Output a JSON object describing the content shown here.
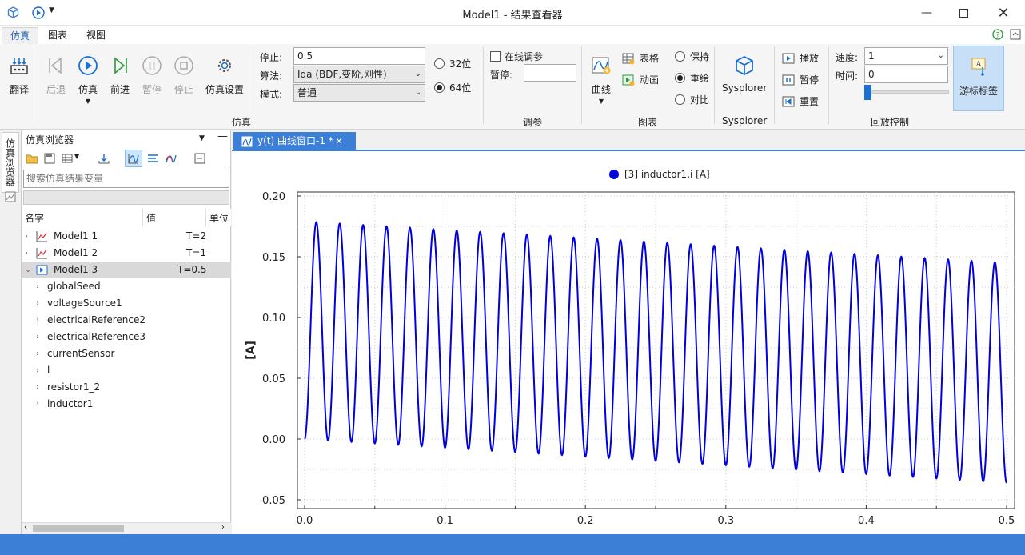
{
  "window": {
    "title": "Model1 - 结果查看器"
  },
  "menu": {
    "tabs": [
      "仿真",
      "图表",
      "视图"
    ],
    "active": 0
  },
  "ribbon": {
    "compile": "翻译",
    "back": "后退",
    "simulate": "仿真",
    "forward": "前进",
    "pause": "暂停",
    "stop": "停止",
    "sim_settings": "仿真设置",
    "stop_label": "停止:",
    "stop_value": "0.5",
    "algo_label": "算法:",
    "algo_value": "Ida (BDF,变阶,刚性)",
    "mode_label": "模式:",
    "mode_value": "普通",
    "bit32": "32位",
    "bit64": "64位",
    "online_tune": "在线调参",
    "pause_label": "暂停:",
    "pause_value": "",
    "curve": "曲线",
    "table": "表格",
    "animation": "动画",
    "keep": "保持",
    "redraw": "重绘",
    "compare": "对比",
    "sysplorer": "Sysplorer",
    "play": "播放",
    "play_pause": "暂停",
    "reset": "重置",
    "speed_label": "速度:",
    "speed_value": "1",
    "time_label": "时间:",
    "time_value": "0",
    "cursor_label": "游标标签",
    "groups": {
      "sim": "仿真",
      "tune": "调参",
      "chart": "图表",
      "sysplorer": "Sysplorer",
      "playback": "回放控制"
    }
  },
  "sidebar": {
    "tab_label": "仿真浏览器"
  },
  "browser": {
    "title": "仿真浏览器",
    "search_placeholder": "搜索仿真结果变量",
    "columns": [
      "名字",
      "值",
      "单位"
    ],
    "rows": [
      {
        "name": "Model1 1",
        "value": "T=2",
        "type": "chart"
      },
      {
        "name": "Model1 2",
        "value": "T=1",
        "type": "chart"
      },
      {
        "name": "Model1 3",
        "value": "T=0.5",
        "type": "play",
        "selected": true,
        "expanded": true
      }
    ],
    "children": [
      "globalSeed",
      "voltageSource1",
      "electricalReference2",
      "electricalReference3",
      "currentSensor",
      "l",
      "resistor1_2",
      "inductor1"
    ]
  },
  "doc_tab": {
    "label": "y(t) 曲线窗口-1 *",
    "close": "×"
  },
  "chart_data": {
    "type": "line",
    "legend": "[3] inductor1.i [A]",
    "ylabel": "[A]",
    "xlim": [
      0,
      0.5
    ],
    "ylim": [
      -0.05,
      0.2
    ],
    "xticks": [
      "0.0",
      "0.1",
      "0.2",
      "0.3",
      "0.4",
      "0.5"
    ],
    "yticks": [
      "0.20",
      "0.15",
      "0.10",
      "0.05",
      "0.00",
      "-0.05"
    ],
    "grid": true,
    "series": [
      {
        "color": "#0000e0",
        "frequency_hz": 60,
        "first_peak": [
          0.0083,
          0.179
        ],
        "last_peak": [
          0.492,
          0.145
        ],
        "first_trough": [
          0.0,
          0.0
        ],
        "last_trough": [
          0.5,
          -0.036
        ]
      }
    ]
  },
  "colors": {
    "accent": "#3b7fd6",
    "series": "#0000e0"
  }
}
